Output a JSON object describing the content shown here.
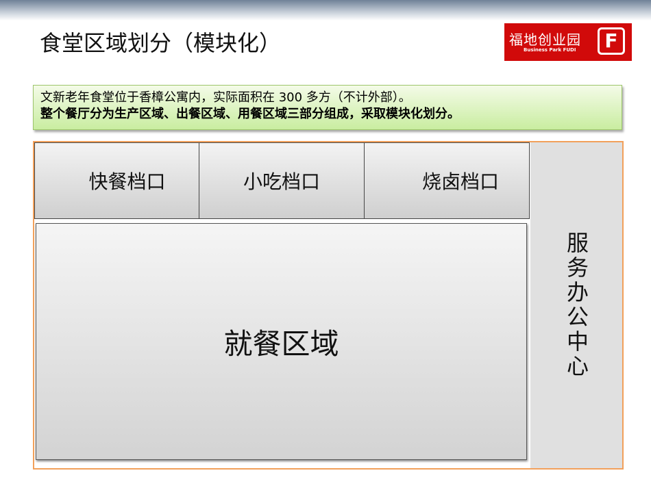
{
  "title": "食堂区域划分（模块化）",
  "logo": {
    "cn": "福地创业园",
    "en": "Business Park FUDI",
    "mark": "F"
  },
  "note": {
    "line1": "文新老年食堂位于香樟公寓内，实际面积在 300 多方（不计外部）。",
    "line2": "整个餐厅分为生产区域、出餐区域、用餐区域三部分组成，采取模块化划分。"
  },
  "stalls": [
    "快餐档口",
    "小吃档口",
    "烧卤档口"
  ],
  "dining": "就餐区域",
  "service": "服务办公中心"
}
